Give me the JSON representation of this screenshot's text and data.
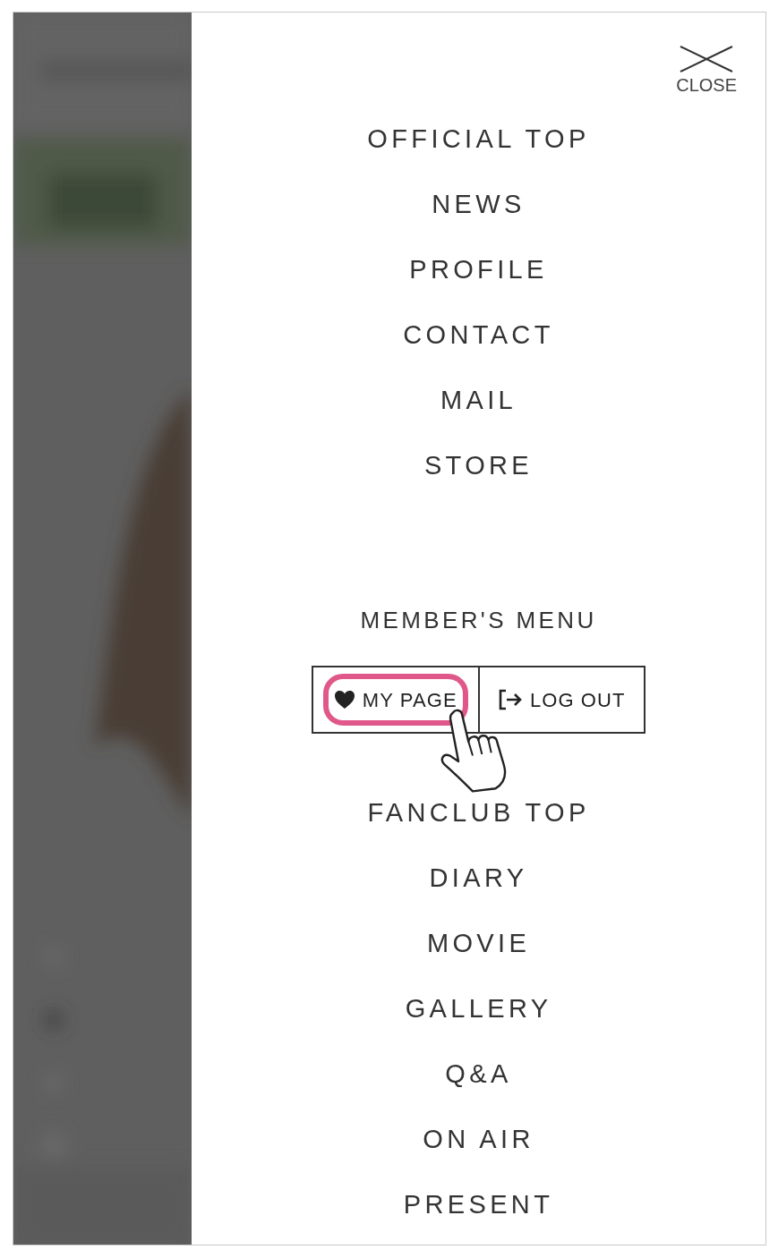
{
  "close": {
    "label": "CLOSE"
  },
  "main_menu": [
    {
      "label": "OFFICIAL TOP"
    },
    {
      "label": "NEWS"
    },
    {
      "label": "PROFILE"
    },
    {
      "label": "CONTACT"
    },
    {
      "label": "MAIL"
    },
    {
      "label": "STORE"
    }
  ],
  "members_menu": {
    "title": "MEMBER'S MENU",
    "buttons": [
      {
        "kind": "mypage",
        "label": "MY PAGE",
        "highlighted": true
      },
      {
        "kind": "logout",
        "label": "LOG OUT",
        "highlighted": false
      }
    ]
  },
  "fanclub_menu": [
    {
      "label": "FANCLUB TOP"
    },
    {
      "label": "DIARY"
    },
    {
      "label": "MOVIE"
    },
    {
      "label": "GALLERY"
    },
    {
      "label": "Q&A"
    },
    {
      "label": "ON AIR"
    },
    {
      "label": "PRESENT"
    }
  ]
}
